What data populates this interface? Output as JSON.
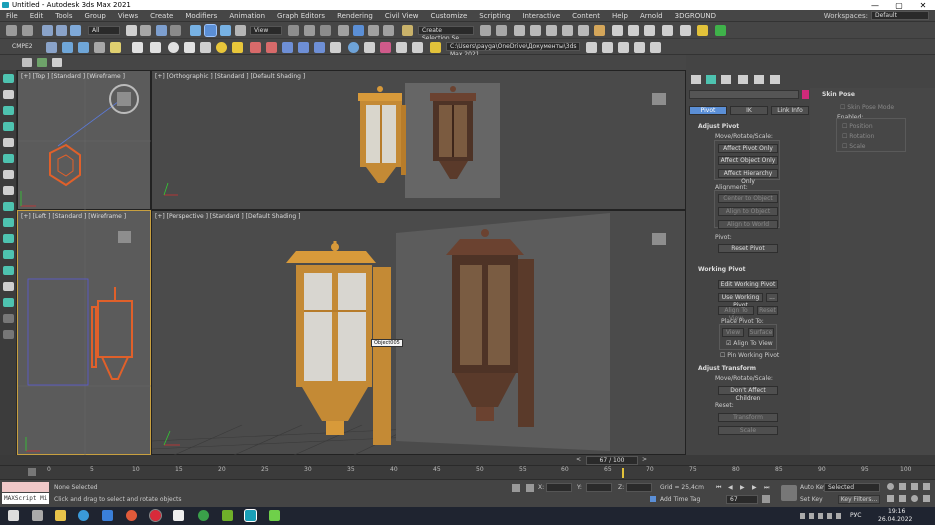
{
  "window": {
    "title": "Untitled - Autodesk 3ds Max 2021",
    "controls": [
      "—",
      "▢",
      "✕"
    ]
  },
  "menu": [
    "File",
    "Edit",
    "Tools",
    "Group",
    "Views",
    "Create",
    "Modifiers",
    "Animation",
    "Graph Editors",
    "Rendering",
    "Civil View",
    "Customize",
    "Scripting",
    "Interactive",
    "Content",
    "Help",
    "Arnold",
    "3DGROUND"
  ],
  "workspace": {
    "label": "Workspaces:",
    "value": "Default"
  },
  "toolbar": {
    "filter": "All",
    "view": "View",
    "selection_set": "Create Selection Se",
    "project_path": "C:\\Users\\payga\\OneDrive\\Документы\\3ds Max 2021",
    "cmpe": "CMPE2"
  },
  "viewports": {
    "top": "[+] [Top ] [Standard ] [Wireframe ]",
    "ortho": "[+] [Orthographic ] [Standard ] [Default Shading ]",
    "left": "[+] [Left ] [Standard ] [Wireframe ]",
    "persp": "[+] [Perspective ] [Standard ] [Default Shading ]",
    "tooltip": "Object005"
  },
  "panel": {
    "tabs": {
      "pivot": "Pivot",
      "ik": "IK",
      "link": "Link Info"
    },
    "adjust_pivot": "Adjust Pivot",
    "move_rotate": "Move/Rotate/Scale:",
    "affect_pivot": "Affect Pivot Only",
    "affect_object": "Affect Object Only",
    "affect_hier": "Affect Hierarchy Only",
    "alignment": "Alignment:",
    "center": "Center to Object",
    "align_obj": "Align to Object",
    "align_world": "Align to World",
    "pivot": "Pivot:",
    "reset_pivot": "Reset Pivot",
    "working_pivot": "Working Pivot",
    "edit_wp": "Edit Working Pivot",
    "use_wp": "Use Working Pivot",
    "dots": "...",
    "align_view": "Align To View",
    "reset": "Reset",
    "place_pivot": "Place Pivot To:",
    "view": "View",
    "surface": "Surface",
    "align_to_view_chk": "Align To View",
    "pin_wp": "Pin Working Pivot",
    "adjust_transform": "Adjust Transform",
    "move_rotate2": "Move/Rotate/Scale:",
    "dont_affect": "Don't Affect Children",
    "reset2": "Reset:",
    "transform": "Transform",
    "scale": "Scale"
  },
  "skin": {
    "title": "Skin Pose",
    "mode": "Skin Pose Mode",
    "enabled": "Enabled:",
    "position": "Position",
    "rotation": "Rotation",
    "scale": "Scale"
  },
  "timeline": {
    "frame": "67 / 100",
    "ticks": [
      "0",
      "5",
      "10",
      "15",
      "20",
      "25",
      "30",
      "35",
      "40",
      "45",
      "50",
      "55",
      "60",
      "65",
      "70",
      "75",
      "80",
      "85",
      "90",
      "95",
      "100"
    ]
  },
  "status": {
    "maxscript": "MAXScript Mi",
    "selected": "None Selected",
    "prompt": "Click and drag to select and rotate objects",
    "x": "X:",
    "y": "Y:",
    "z": "Z:",
    "grid": "Grid = 25,4cm",
    "add_time_tag": "Add Time Tag",
    "frame_field": "67",
    "auto_key": "Auto Key",
    "set_key": "Set Key",
    "selected_combo": "Selected",
    "key_filters": "Key Filters..."
  },
  "taskbar": {
    "lang": "РУС",
    "time": "19:16",
    "date": "26.04.2022"
  },
  "colors": {
    "accent": "#5b8fd6",
    "lamp_gold": "#d89a3a",
    "lamp_bronze": "#6b4230",
    "selected_orange": "#e0602a"
  }
}
